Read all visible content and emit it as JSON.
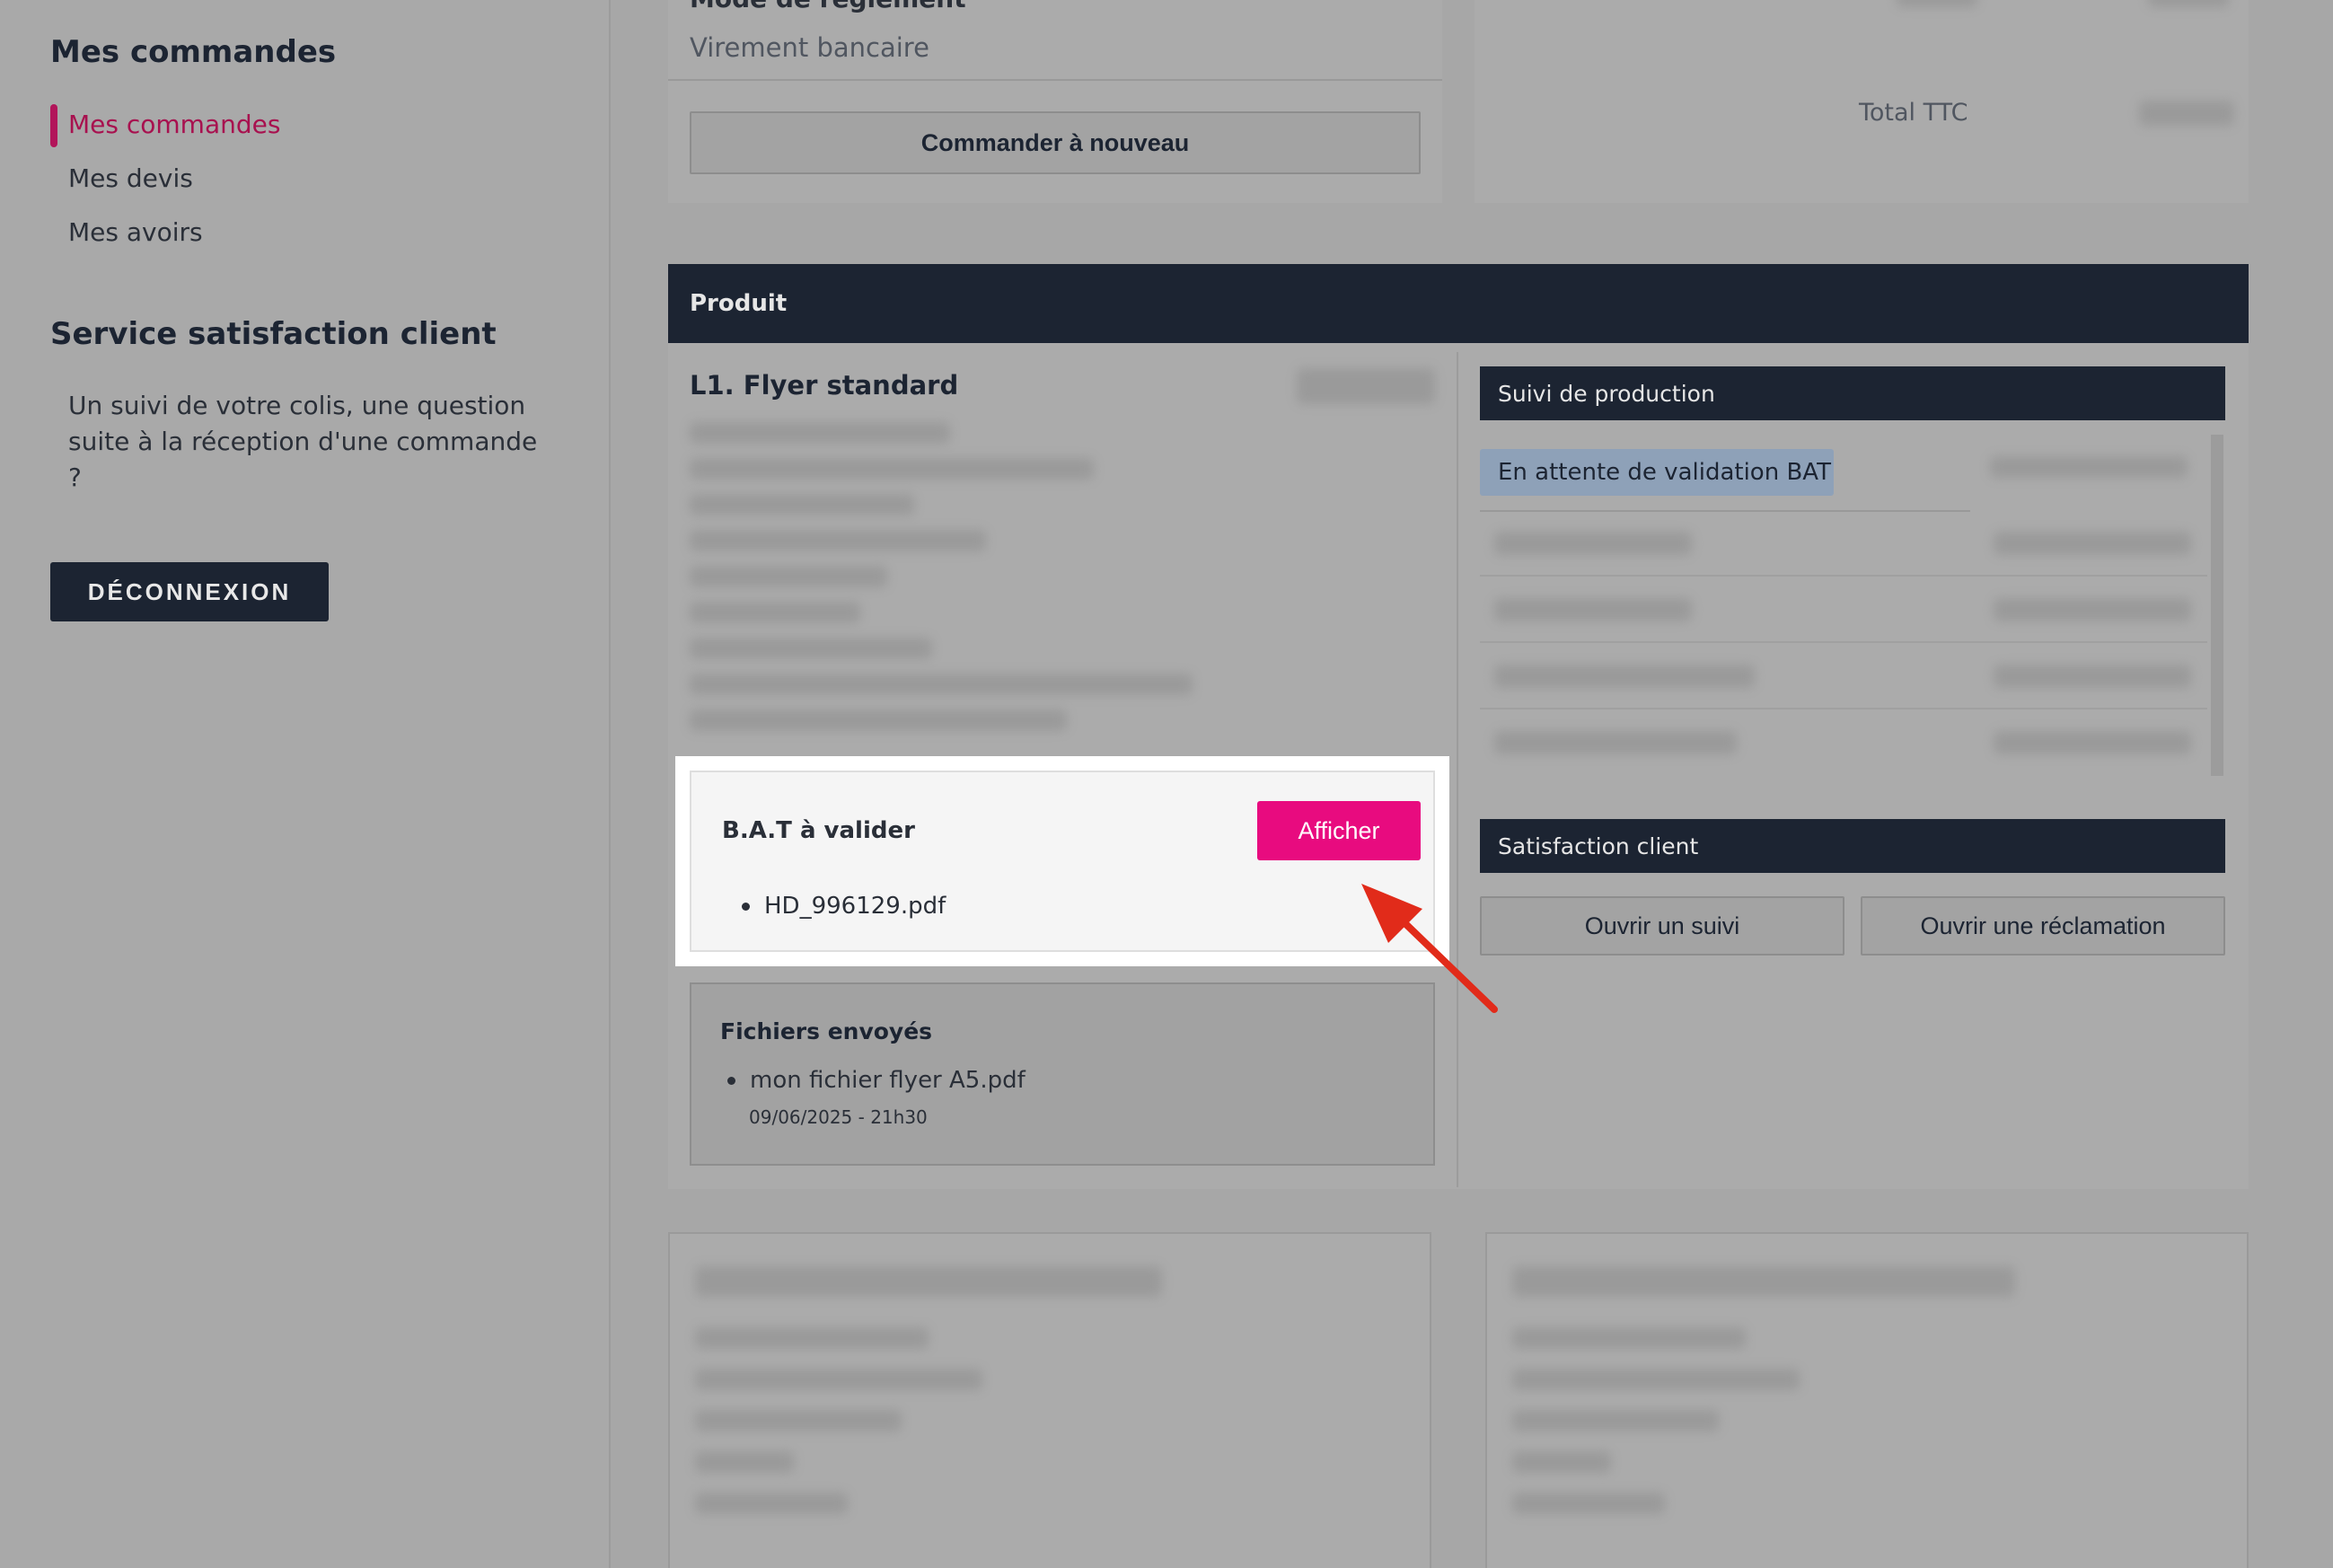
{
  "sidebar": {
    "orders_title": "Mes commandes",
    "nav": [
      "Mes commandes",
      "Mes devis",
      "Mes avoirs"
    ],
    "service_title": "Service satisfaction client",
    "service_text": "Un suivi de votre colis, une question suite à la réception d'une commande ?",
    "logout_label": "DÉCONNEXION"
  },
  "order": {
    "payment_label": "Mode de règlement",
    "payment_value": "Virement bancaire",
    "reorder_label": "Commander à nouveau",
    "total_label": "Total TTC"
  },
  "product": {
    "header": "Produit",
    "name": "L1. Flyer standard",
    "bat": {
      "title": "B.A.T à valider",
      "button": "Afficher",
      "file": "HD_996129.pdf"
    },
    "sent_files": {
      "title": "Fichiers envoyés",
      "file": "mon fichier flyer A5.pdf",
      "date": "09/06/2025 - 21h30"
    }
  },
  "production": {
    "header": "Suivi de production",
    "current_step": "En attente de validation BAT"
  },
  "satisfaction": {
    "header": "Satisfaction client",
    "open_follow": "Ouvrir un suivi",
    "open_claim": "Ouvrir une réclamation"
  },
  "colors": {
    "accent": "#e80b7f",
    "nav_active": "#a8114f",
    "dark": "#1c2432"
  }
}
